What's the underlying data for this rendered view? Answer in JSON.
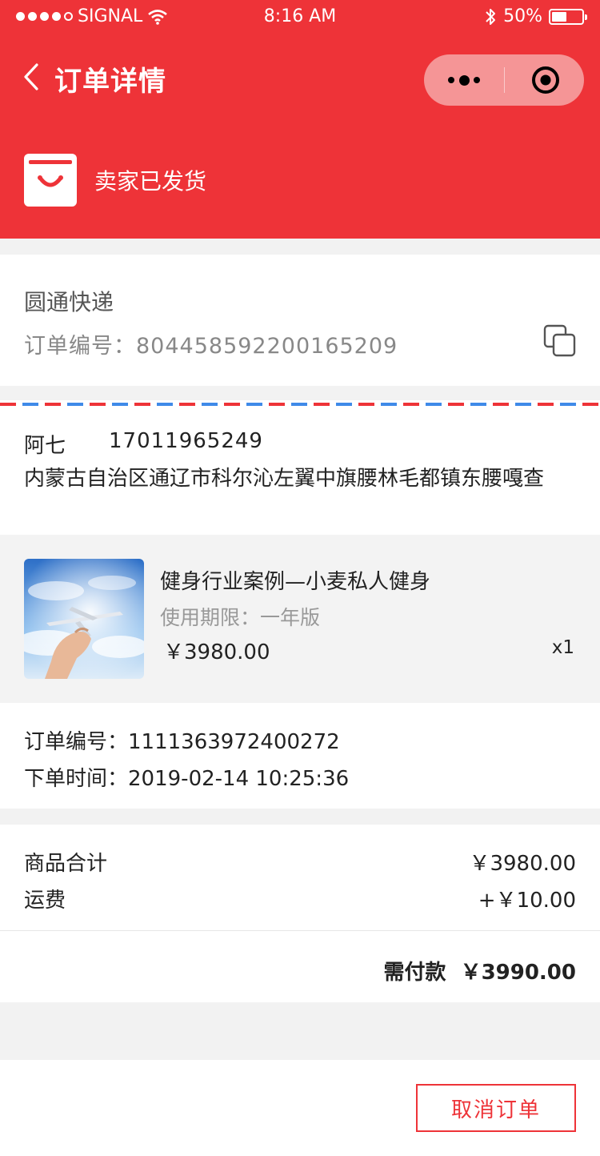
{
  "status_bar": {
    "carrier": "SIGNAL",
    "time": "8:16 AM",
    "battery": "50%",
    "battery_level": 0.5
  },
  "nav": {
    "title": "订单详情",
    "back_icon": "chevron-left-icon",
    "more_icon": "more-dots-icon",
    "close_icon": "target-close-icon"
  },
  "order_status": {
    "icon": "shopping-bag-icon",
    "text": "卖家已发货"
  },
  "logistics": {
    "courier": "圆通快递",
    "tracking_label": "订单编号：",
    "tracking_number": "804458592200165209",
    "copy_icon": "copy-icon"
  },
  "address": {
    "name": "阿七",
    "phone": "17011965249",
    "detail": "内蒙古自治区通辽市科尔沁左翼中旗腰林毛都镇东腰嘎查"
  },
  "product": {
    "image_icon": "airplane-in-hand-image",
    "name": "健身行业案例—小麦私人健身",
    "spec_label": "使用期限：",
    "spec_value": "一年版",
    "price": "￥3980.00",
    "quantity": "x1"
  },
  "order_info": {
    "number_label": "订单编号：",
    "number": "1111363972400272",
    "time_label": "下单时间：",
    "time": "2019-02-14 10:25:36"
  },
  "price_summary": {
    "subtotal_label": "商品合计",
    "subtotal": "￥3980.00",
    "shipping_label": "运费",
    "shipping": "+￥10.00",
    "total_label": "需付款",
    "total": "￥3990.00"
  },
  "footer": {
    "cancel_label": "取消订单"
  },
  "colors": {
    "brand_red": "#ee3338",
    "capsule": "#f59596",
    "stripe_blue": "#3f8ae8"
  }
}
